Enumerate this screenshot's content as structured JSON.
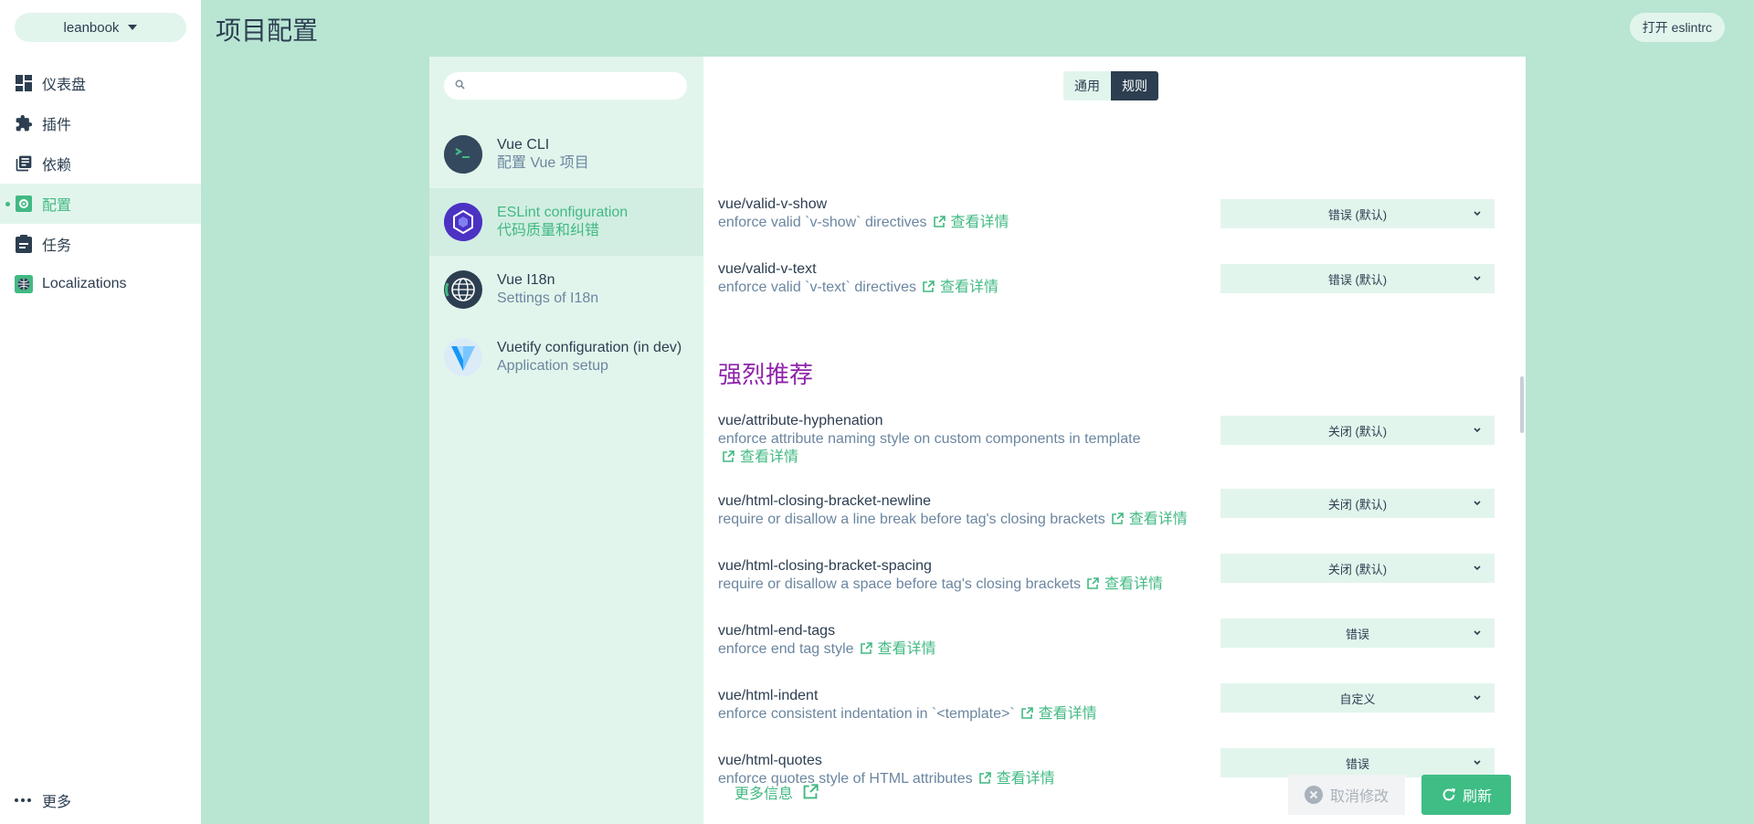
{
  "project": {
    "name": "leanbook"
  },
  "nav": {
    "items": [
      {
        "label": "仪表盘",
        "icon": "dashboard-icon"
      },
      {
        "label": "插件",
        "icon": "puzzle-icon"
      },
      {
        "label": "依赖",
        "icon": "library-icon"
      },
      {
        "label": "配置",
        "icon": "settings-icon",
        "active": true
      },
      {
        "label": "任务",
        "icon": "clipboard-icon"
      },
      {
        "label": "Localizations",
        "icon": "globe-icon"
      }
    ],
    "more_label": "更多"
  },
  "header": {
    "title": "项目配置",
    "open_button_label": "打开 eslintrc"
  },
  "search": {
    "placeholder": "",
    "value": ""
  },
  "plugins": [
    {
      "name": "Vue CLI",
      "description": "配置 Vue 项目",
      "icon": "terminal-icon"
    },
    {
      "name": "ESLint configuration",
      "description": "代码质量和纠错",
      "icon": "eslint-icon",
      "active": true
    },
    {
      "name": "Vue I18n",
      "description": "Settings of I18n",
      "icon": "globe-icon"
    },
    {
      "name": "Vuetify configuration (in dev)",
      "description": "Application setup",
      "icon": "vuetify-icon"
    }
  ],
  "tabs": [
    {
      "label": "通用"
    },
    {
      "label": "规则",
      "active": true
    }
  ],
  "details_label": "查看详情",
  "section_recommended": "强烈推荐",
  "rules": [
    {
      "name": "vue/valid-v-show",
      "description": "enforce valid `v-show` directives",
      "value": "错误 (默认)"
    },
    {
      "name": "vue/valid-v-text",
      "description": "enforce valid `v-text` directives",
      "value": "错误 (默认)"
    },
    {
      "name": "vue/attribute-hyphenation",
      "description": "enforce attribute naming style on custom components in template",
      "value": "关闭 (默认)"
    },
    {
      "name": "vue/html-closing-bracket-newline",
      "description": "require or disallow a line break before tag's closing brackets",
      "value": "关闭 (默认)"
    },
    {
      "name": "vue/html-closing-bracket-spacing",
      "description": "require or disallow a space before tag's closing brackets",
      "value": "关闭 (默认)"
    },
    {
      "name": "vue/html-end-tags",
      "description": "enforce end tag style",
      "value": "错误"
    },
    {
      "name": "vue/html-indent",
      "description": "enforce consistent indentation in `<template>`",
      "value": "自定义"
    },
    {
      "name": "vue/html-quotes",
      "description": "enforce quotes style of HTML attributes",
      "value": "错误"
    }
  ],
  "footer": {
    "more_info_label": "更多信息",
    "cancel_label": "取消修改",
    "refresh_label": "刷新"
  },
  "colors": {
    "background": "#b9e5d3",
    "accent": "#42b983",
    "section_title": "#8e24aa",
    "dark": "#2c3e50"
  }
}
